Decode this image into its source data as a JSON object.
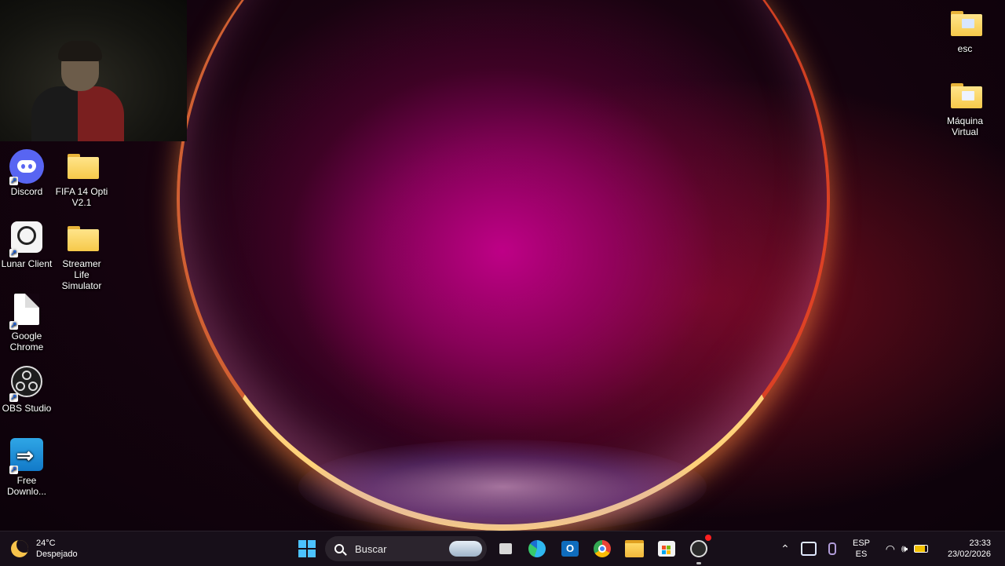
{
  "desktop": {
    "icons_left": [
      {
        "id": "discord",
        "label": "Discord",
        "icon": "discord-icon"
      },
      {
        "id": "fifa",
        "label": "FIFA 14 Opti V2.1",
        "icon": "folder-icon"
      },
      {
        "id": "lunar",
        "label": "Lunar Client",
        "icon": "lunar-client-icon"
      },
      {
        "id": "streamer",
        "label": "Streamer Life Simulator",
        "icon": "folder-icon"
      },
      {
        "id": "chrome",
        "label": "Google Chrome",
        "icon": "blank-file-icon"
      },
      {
        "id": "obs",
        "label": "OBS Studio",
        "icon": "obs-icon"
      },
      {
        "id": "fdm",
        "label": "Free Downlo...",
        "icon": "free-download-manager-icon"
      }
    ],
    "icons_right": [
      {
        "id": "esc",
        "label": "esc",
        "icon": "folder-icon"
      },
      {
        "id": "maquina",
        "label": "Máquina Virtual",
        "icon": "folder-icon"
      }
    ]
  },
  "taskbar": {
    "weather": {
      "temp": "24°C",
      "condition": "Despejado"
    },
    "search_placeholder": "Buscar",
    "pinned": [
      "windows-start-icon",
      "task-view-icon",
      "edge-icon",
      "outlook-icon",
      "chrome-icon",
      "file-explorer-icon",
      "microsoft-store-icon",
      "obs-icon"
    ],
    "tray": {
      "lang_top": "ESP",
      "lang_bottom": "ES",
      "time": "23:33",
      "date": "23/02/2026"
    }
  },
  "colors": {
    "accent": "#4cc2ff",
    "taskbar": "#18101a",
    "wallpaper_core": "#c4008c"
  }
}
